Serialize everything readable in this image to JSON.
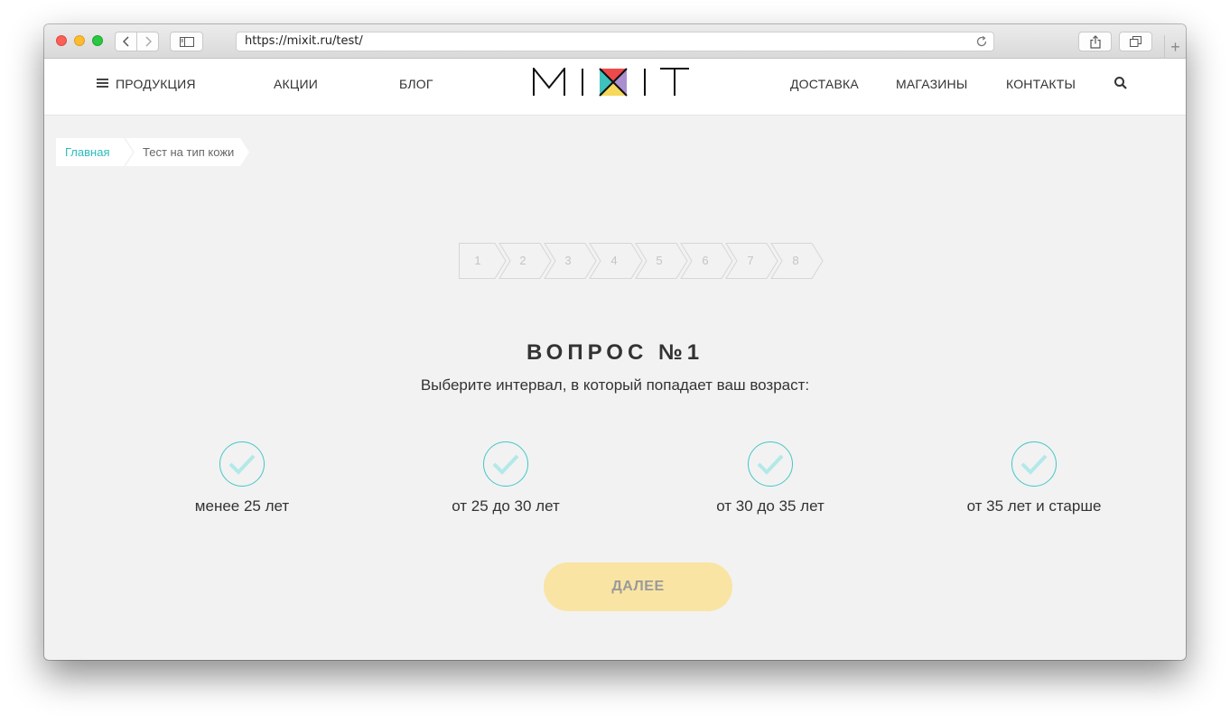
{
  "browser": {
    "url": "https://mixit.ru/test/"
  },
  "header": {
    "nav_left": [
      "ПРОДУКЦИЯ",
      "АКЦИИ",
      "БЛОГ"
    ],
    "logo_text": "MIXIT",
    "nav_right": [
      "ДОСТАВКА",
      "МАГАЗИНЫ",
      "КОНТАКТЫ"
    ]
  },
  "breadcrumbs": {
    "home": "Главная",
    "current": "Тест на тип кожи"
  },
  "steps": [
    "1",
    "2",
    "3",
    "4",
    "5",
    "6",
    "7",
    "8"
  ],
  "question": {
    "title": "ВОПРОС №1",
    "text": "Выберите интервал, в который попадает ваш возраст:"
  },
  "options": [
    "менее 25 лет",
    "от 25 до 30 лет",
    "от 30 до 35 лет",
    "от 35 лет и старше"
  ],
  "next_label": "ДАЛЕЕ",
  "colors": {
    "accent_teal": "#45c7c8",
    "breadcrumb_link": "#2bbdbb",
    "next_button": "#f9e4a4",
    "logo_red": "#ef4a4a",
    "logo_purple": "#a98fd0",
    "logo_yellow": "#f6d85b",
    "logo_teal": "#3fc2bd"
  }
}
